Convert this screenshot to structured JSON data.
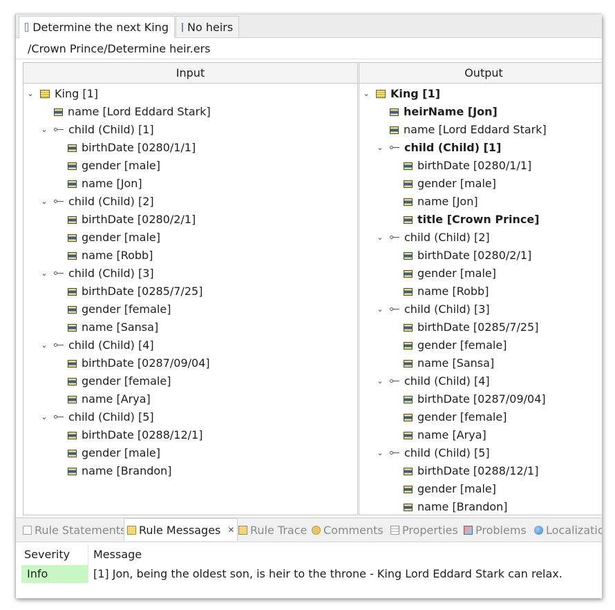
{
  "editor_tabs": [
    {
      "label": "Determine the next King",
      "active": true
    },
    {
      "label": "No heirs",
      "active": false
    }
  ],
  "path": "/Crown Prince/Determine heir.ers",
  "input": {
    "header": "Input",
    "rows": [
      {
        "text": "King [1]",
        "icon": "entity-icon",
        "twisty": "expanded",
        "bold": false
      },
      {
        "text": "name [Lord Eddard Stark]",
        "icon": "attribute-icon",
        "twisty": "none",
        "bold": false
      },
      {
        "text": "child (Child) [1]",
        "icon": "relation-icon",
        "twisty": "expanded",
        "bold": false
      },
      {
        "text": "birthDate [0280/1/1]",
        "icon": "attribute-icon",
        "twisty": "none",
        "bold": false
      },
      {
        "text": "gender [male]",
        "icon": "attribute-icon",
        "twisty": "none",
        "bold": false
      },
      {
        "text": "name [Jon]",
        "icon": "attribute-icon",
        "twisty": "none",
        "bold": false
      },
      {
        "text": "child (Child) [2]",
        "icon": "relation-icon",
        "twisty": "expanded",
        "bold": false
      },
      {
        "text": "birthDate [0280/2/1]",
        "icon": "attribute-icon",
        "twisty": "none",
        "bold": false
      },
      {
        "text": "gender [male]",
        "icon": "attribute-icon",
        "twisty": "none",
        "bold": false
      },
      {
        "text": "name [Robb]",
        "icon": "attribute-icon",
        "twisty": "none",
        "bold": false
      },
      {
        "text": "child (Child) [3]",
        "icon": "relation-icon",
        "twisty": "expanded",
        "bold": false
      },
      {
        "text": "birthDate [0285/7/25]",
        "icon": "attribute-icon",
        "twisty": "none",
        "bold": false
      },
      {
        "text": "gender [female]",
        "icon": "attribute-icon",
        "twisty": "none",
        "bold": false
      },
      {
        "text": "name [Sansa]",
        "icon": "attribute-icon",
        "twisty": "none",
        "bold": false
      },
      {
        "text": "child (Child) [4]",
        "icon": "relation-icon",
        "twisty": "expanded",
        "bold": false
      },
      {
        "text": "birthDate [0287/09/04]",
        "icon": "attribute-icon",
        "twisty": "none",
        "bold": false
      },
      {
        "text": "gender [female]",
        "icon": "attribute-icon",
        "twisty": "none",
        "bold": false
      },
      {
        "text": "name [Arya]",
        "icon": "attribute-icon",
        "twisty": "none",
        "bold": false
      },
      {
        "text": "child (Child) [5]",
        "icon": "relation-icon",
        "twisty": "expanded",
        "bold": false
      },
      {
        "text": "birthDate [0288/12/1]",
        "icon": "attribute-icon",
        "twisty": "none",
        "bold": false
      },
      {
        "text": "gender [male]",
        "icon": "attribute-icon",
        "twisty": "none",
        "bold": false
      },
      {
        "text": "name [Brandon]",
        "icon": "attribute-icon",
        "twisty": "none",
        "bold": false
      }
    ]
  },
  "output": {
    "header": "Output",
    "rows": [
      {
        "text": "King [1]",
        "icon": "entity-icon",
        "twisty": "expanded",
        "bold": true
      },
      {
        "text": "heirName [Jon]",
        "icon": "attribute-icon",
        "twisty": "none",
        "bold": true
      },
      {
        "text": "name [Lord Eddard Stark]",
        "icon": "attribute-icon",
        "twisty": "none",
        "bold": false
      },
      {
        "text": "child (Child) [1]",
        "icon": "relation-icon",
        "twisty": "expanded",
        "bold": true
      },
      {
        "text": "birthDate [0280/1/1]",
        "icon": "attribute-icon",
        "twisty": "none",
        "bold": false
      },
      {
        "text": "gender [male]",
        "icon": "attribute-icon",
        "twisty": "none",
        "bold": false
      },
      {
        "text": "name [Jon]",
        "icon": "attribute-icon",
        "twisty": "none",
        "bold": false
      },
      {
        "text": "title [Crown Prince]",
        "icon": "attribute-icon",
        "twisty": "none",
        "bold": true
      },
      {
        "text": "child (Child) [2]",
        "icon": "relation-icon",
        "twisty": "expanded",
        "bold": false
      },
      {
        "text": "birthDate [0280/2/1]",
        "icon": "attribute-icon",
        "twisty": "none",
        "bold": false
      },
      {
        "text": "gender [male]",
        "icon": "attribute-icon",
        "twisty": "none",
        "bold": false
      },
      {
        "text": "name [Robb]",
        "icon": "attribute-icon",
        "twisty": "none",
        "bold": false
      },
      {
        "text": "child (Child) [3]",
        "icon": "relation-icon",
        "twisty": "expanded",
        "bold": false
      },
      {
        "text": "birthDate [0285/7/25]",
        "icon": "attribute-icon",
        "twisty": "none",
        "bold": false
      },
      {
        "text": "gender [female]",
        "icon": "attribute-icon",
        "twisty": "none",
        "bold": false
      },
      {
        "text": "name [Sansa]",
        "icon": "attribute-icon",
        "twisty": "none",
        "bold": false
      },
      {
        "text": "child (Child) [4]",
        "icon": "relation-icon",
        "twisty": "expanded",
        "bold": false
      },
      {
        "text": "birthDate [0287/09/04]",
        "icon": "attribute-icon",
        "twisty": "none",
        "bold": false
      },
      {
        "text": "gender [female]",
        "icon": "attribute-icon",
        "twisty": "none",
        "bold": false
      },
      {
        "text": "name [Arya]",
        "icon": "attribute-icon",
        "twisty": "none",
        "bold": false
      },
      {
        "text": "child (Child) [5]",
        "icon": "relation-icon",
        "twisty": "expanded",
        "bold": false
      },
      {
        "text": "birthDate [0288/12/1]",
        "icon": "attribute-icon",
        "twisty": "none",
        "bold": false
      },
      {
        "text": "gender [male]",
        "icon": "attribute-icon",
        "twisty": "none",
        "bold": false
      },
      {
        "text": "name [Brandon]",
        "icon": "attribute-icon",
        "twisty": "none",
        "bold": false
      }
    ]
  },
  "bottom_tabs": [
    {
      "label": "Rule Statements",
      "icon": "document-icon",
      "active": false
    },
    {
      "label": "Rule Messages",
      "icon": "envelope-icon",
      "active": true
    },
    {
      "label": "Rule Trace",
      "icon": "envelope-icon",
      "active": false
    },
    {
      "label": "Comments",
      "icon": "comment-icon",
      "active": false
    },
    {
      "label": "Properties",
      "icon": "properties-icon",
      "active": false
    },
    {
      "label": "Problems",
      "icon": "problems-icon",
      "active": false
    },
    {
      "label": "Localizatio",
      "icon": "globe-icon",
      "active": false
    }
  ],
  "messages": {
    "columns": [
      "Severity",
      "Message"
    ],
    "rows": [
      {
        "severity": "Info",
        "message": "[1] Jon, being the oldest son, is heir to the throne - King Lord Eddard Stark can relax."
      }
    ]
  },
  "colors": {
    "info_background": "#c9f7c4",
    "accent": "#2c5fa8"
  }
}
